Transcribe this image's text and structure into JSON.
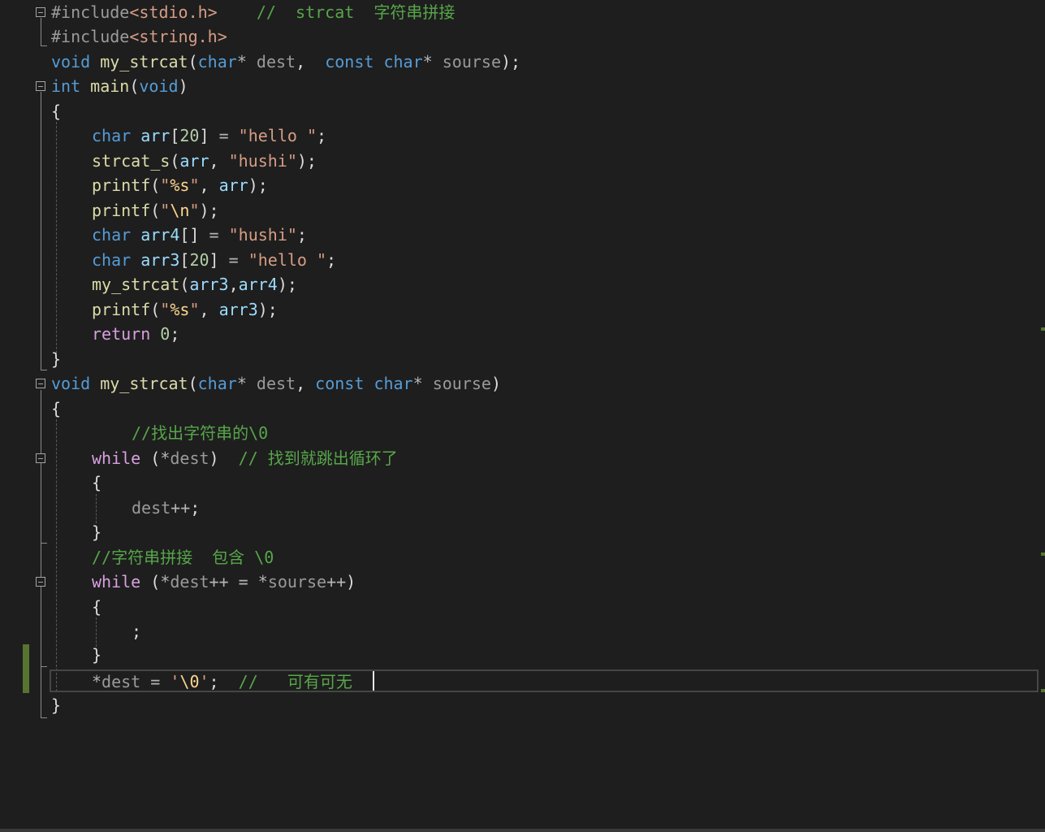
{
  "editor": {
    "lines": [
      {
        "tokens": [
          [
            "pp",
            "#include"
          ],
          [
            "inc",
            "<stdio.h>"
          ],
          [
            "pl",
            "    "
          ],
          [
            "cm",
            "//  strcat  字符串拼接"
          ]
        ]
      },
      {
        "tokens": [
          [
            "pp",
            "#include"
          ],
          [
            "inc",
            "<string.h>"
          ]
        ]
      },
      {
        "tokens": [
          [
            "kw",
            "void"
          ],
          [
            "pl",
            " "
          ],
          [
            "fn",
            "my_strcat"
          ],
          [
            "pl",
            "("
          ],
          [
            "kw",
            "char"
          ],
          [
            "op",
            "*"
          ],
          [
            "pl",
            " "
          ],
          [
            "prm",
            "dest"
          ],
          [
            "pl",
            ",  "
          ],
          [
            "kw",
            "const"
          ],
          [
            "pl",
            " "
          ],
          [
            "kw",
            "char"
          ],
          [
            "op",
            "*"
          ],
          [
            "pl",
            " "
          ],
          [
            "prm",
            "sourse"
          ],
          [
            "pl",
            ");"
          ]
        ]
      },
      {
        "tokens": [
          [
            "kw",
            "int"
          ],
          [
            "pl",
            " "
          ],
          [
            "fn",
            "main"
          ],
          [
            "pl",
            "("
          ],
          [
            "kw",
            "void"
          ],
          [
            "pl",
            ")"
          ]
        ]
      },
      {
        "tokens": [
          [
            "pl",
            "{"
          ]
        ]
      },
      {
        "tokens": [
          [
            "kw",
            "char"
          ],
          [
            "pl",
            " "
          ],
          [
            "var",
            "arr"
          ],
          [
            "pl",
            "["
          ],
          [
            "num",
            "20"
          ],
          [
            "pl",
            "] "
          ],
          [
            "op",
            "="
          ],
          [
            "pl",
            " "
          ],
          [
            "str",
            "\"hello \""
          ],
          [
            "pl",
            ";"
          ]
        ]
      },
      {
        "tokens": [
          [
            "fn",
            "strcat_s"
          ],
          [
            "pl",
            "("
          ],
          [
            "var",
            "arr"
          ],
          [
            "pl",
            ", "
          ],
          [
            "str",
            "\"hushi\""
          ],
          [
            "pl",
            ");"
          ]
        ]
      },
      {
        "tokens": [
          [
            "fn",
            "printf"
          ],
          [
            "pl",
            "("
          ],
          [
            "str",
            "\""
          ],
          [
            "esc",
            "%s"
          ],
          [
            "str",
            "\""
          ],
          [
            "pl",
            ", "
          ],
          [
            "var",
            "arr"
          ],
          [
            "pl",
            ");"
          ]
        ]
      },
      {
        "tokens": [
          [
            "fn",
            "printf"
          ],
          [
            "pl",
            "("
          ],
          [
            "str",
            "\""
          ],
          [
            "esc",
            "\\n"
          ],
          [
            "str",
            "\""
          ],
          [
            "pl",
            ");"
          ]
        ]
      },
      {
        "tokens": [
          [
            "kw",
            "char"
          ],
          [
            "pl",
            " "
          ],
          [
            "var",
            "arr4"
          ],
          [
            "pl",
            "[] "
          ],
          [
            "op",
            "="
          ],
          [
            "pl",
            " "
          ],
          [
            "str",
            "\"hushi\""
          ],
          [
            "pl",
            ";"
          ]
        ]
      },
      {
        "tokens": [
          [
            "kw",
            "char"
          ],
          [
            "pl",
            " "
          ],
          [
            "var",
            "arr3"
          ],
          [
            "pl",
            "["
          ],
          [
            "num",
            "20"
          ],
          [
            "pl",
            "] "
          ],
          [
            "op",
            "="
          ],
          [
            "pl",
            " "
          ],
          [
            "str",
            "\"hello \""
          ],
          [
            "pl",
            ";"
          ]
        ]
      },
      {
        "tokens": [
          [
            "fn",
            "my_strcat"
          ],
          [
            "pl",
            "("
          ],
          [
            "var",
            "arr3"
          ],
          [
            "pl",
            ","
          ],
          [
            "var",
            "arr4"
          ],
          [
            "pl",
            ");"
          ]
        ]
      },
      {
        "tokens": [
          [
            "fn",
            "printf"
          ],
          [
            "pl",
            "("
          ],
          [
            "str",
            "\""
          ],
          [
            "esc",
            "%s"
          ],
          [
            "str",
            "\""
          ],
          [
            "pl",
            ", "
          ],
          [
            "var",
            "arr3"
          ],
          [
            "pl",
            ");"
          ]
        ]
      },
      {
        "tokens": [
          [
            "ctl",
            "return"
          ],
          [
            "pl",
            " "
          ],
          [
            "num",
            "0"
          ],
          [
            "pl",
            ";"
          ]
        ]
      },
      {
        "tokens": [
          [
            "pl",
            "}"
          ]
        ]
      },
      {
        "tokens": [
          [
            "kw",
            "void"
          ],
          [
            "pl",
            " "
          ],
          [
            "fn",
            "my_strcat"
          ],
          [
            "pl",
            "("
          ],
          [
            "kw",
            "char"
          ],
          [
            "op",
            "*"
          ],
          [
            "pl",
            " "
          ],
          [
            "prm",
            "dest"
          ],
          [
            "pl",
            ", "
          ],
          [
            "kw",
            "const"
          ],
          [
            "pl",
            " "
          ],
          [
            "kw",
            "char"
          ],
          [
            "op",
            "*"
          ],
          [
            "pl",
            " "
          ],
          [
            "prm",
            "sourse"
          ],
          [
            "pl",
            ")"
          ]
        ]
      },
      {
        "tokens": [
          [
            "pl",
            "{"
          ]
        ]
      },
      {
        "tokens": [
          [
            "cm",
            "//找出字符串的\\0"
          ]
        ]
      },
      {
        "tokens": [
          [
            "ctl",
            "while"
          ],
          [
            "pl",
            " ("
          ],
          [
            "op",
            "*"
          ],
          [
            "prm",
            "dest"
          ],
          [
            "pl",
            ")  "
          ],
          [
            "cm",
            "// 找到就跳出循环了"
          ]
        ]
      },
      {
        "tokens": [
          [
            "pl",
            "{"
          ]
        ]
      },
      {
        "tokens": [
          [
            "prm",
            "dest"
          ],
          [
            "op",
            "++"
          ],
          [
            "pl",
            ";"
          ]
        ]
      },
      {
        "tokens": [
          [
            "pl",
            "}"
          ]
        ]
      },
      {
        "tokens": [
          [
            "cm",
            "//字符串拼接  包含 \\0"
          ]
        ]
      },
      {
        "tokens": [
          [
            "ctl",
            "while"
          ],
          [
            "pl",
            " ("
          ],
          [
            "op",
            "*"
          ],
          [
            "prm",
            "dest"
          ],
          [
            "op",
            "++"
          ],
          [
            "pl",
            " "
          ],
          [
            "op",
            "="
          ],
          [
            "pl",
            " "
          ],
          [
            "op",
            "*"
          ],
          [
            "prm",
            "sourse"
          ],
          [
            "op",
            "++"
          ],
          [
            "pl",
            ")"
          ]
        ]
      },
      {
        "tokens": [
          [
            "pl",
            "{"
          ]
        ]
      },
      {
        "tokens": [
          [
            "pl",
            ";"
          ]
        ]
      },
      {
        "tokens": [
          [
            "pl",
            "}"
          ]
        ]
      },
      {
        "tokens": [
          [
            "op",
            "*"
          ],
          [
            "prm",
            "dest"
          ],
          [
            "pl",
            " "
          ],
          [
            "op",
            "="
          ],
          [
            "pl",
            " "
          ],
          [
            "str",
            "'"
          ],
          [
            "esc",
            "\\0"
          ],
          [
            "str",
            "'"
          ],
          [
            "pl",
            ";  "
          ],
          [
            "cm",
            "//   可有可无"
          ]
        ]
      },
      {
        "tokens": [
          [
            "pl",
            "}"
          ]
        ]
      }
    ]
  }
}
